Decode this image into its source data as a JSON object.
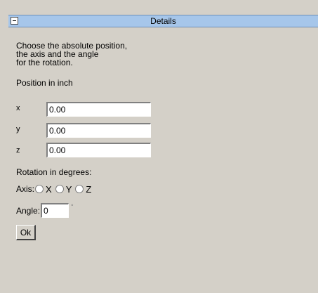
{
  "panel": {
    "title": "Details"
  },
  "description": {
    "line1": "Choose the absolute position,",
    "line2": "the axis and the angle",
    "line3": "for the rotation."
  },
  "position": {
    "label": "Position in inch",
    "x_label": "x",
    "x_value": "0.00",
    "y_label": "y",
    "y_value": "0.00",
    "z_label": "z",
    "z_value": "0.00"
  },
  "rotation": {
    "label": "Rotation in degrees:",
    "axis_label": "Axis:",
    "axis_x": "X",
    "axis_y": "Y",
    "axis_z": "Z",
    "angle_label": "Angle:",
    "angle_value": "0",
    "degree_mark": "°"
  },
  "actions": {
    "ok_label": "Ok"
  }
}
